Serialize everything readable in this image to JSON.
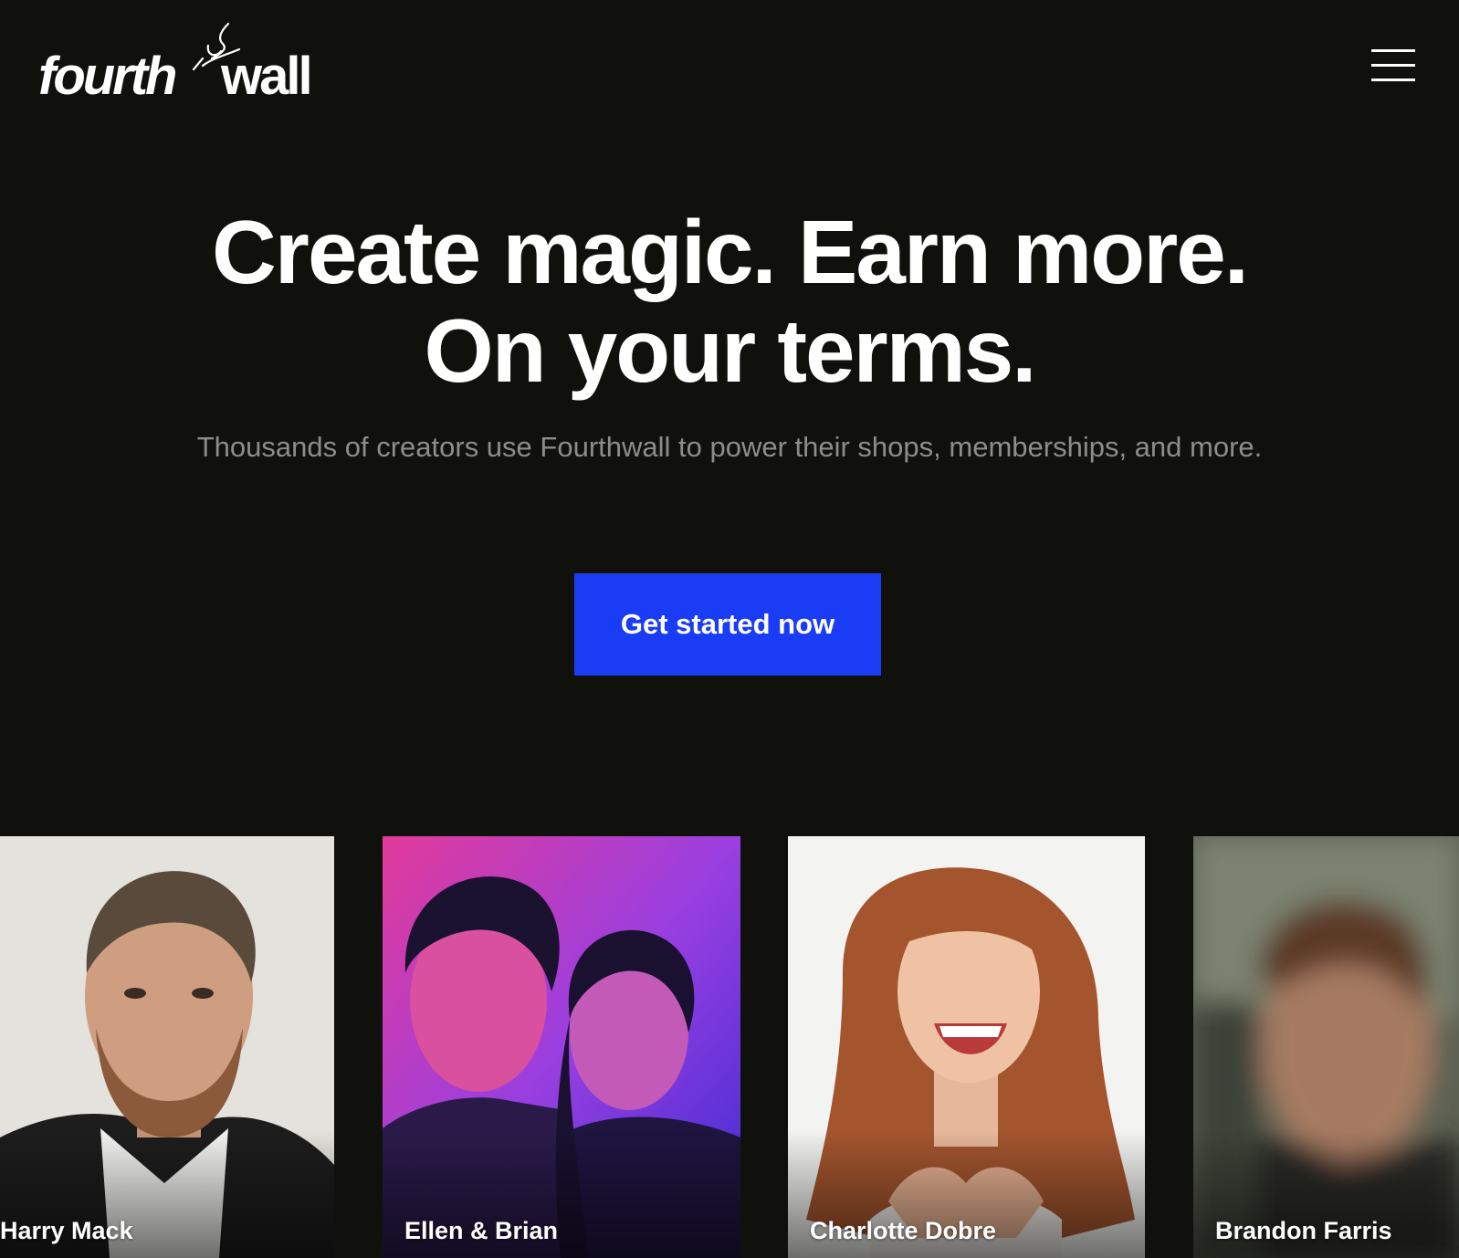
{
  "brand": {
    "logo_left": "fourth",
    "logo_right": "wall",
    "name": "Fourthwall"
  },
  "header": {
    "menu_icon": "hamburger-menu-icon"
  },
  "hero": {
    "title": "Create magic. Earn more. On your terms.",
    "subtitle": "Thousands of creators use Fourthwall to power their shops, memberships, and more.",
    "cta_label": "Get started now"
  },
  "creators": [
    {
      "name": "Harry Mack"
    },
    {
      "name": "Ellen & Brian"
    },
    {
      "name": "Charlotte Dobre"
    },
    {
      "name": "Brandon Farris"
    }
  ],
  "colors": {
    "background": "#10100d",
    "accent": "#1a3cf5",
    "subtitle": "#8e8e88",
    "text": "#ffffff"
  }
}
